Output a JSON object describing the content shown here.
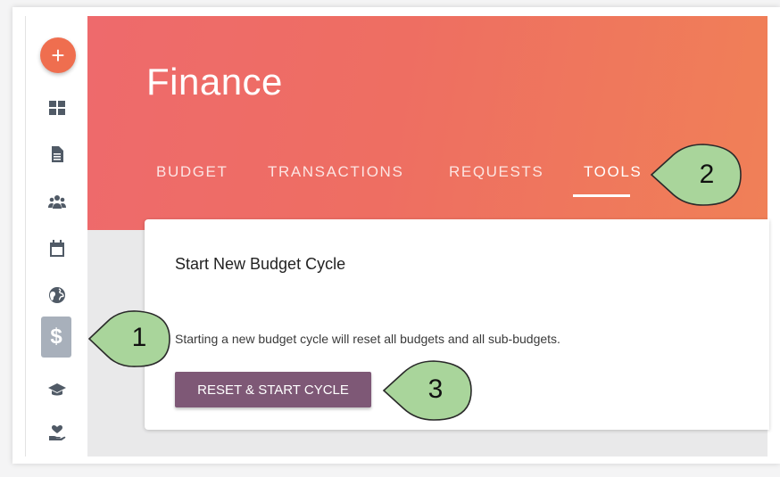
{
  "sidebar": {
    "add_button_symbol": "+",
    "items": [
      {
        "name": "dashboard",
        "icon": "grid-icon"
      },
      {
        "name": "documents",
        "icon": "document-icon"
      },
      {
        "name": "people",
        "icon": "people-icon"
      },
      {
        "name": "calendar",
        "icon": "calendar-icon"
      },
      {
        "name": "globe",
        "icon": "globe-icon"
      },
      {
        "name": "finance",
        "icon": "dollar-icon",
        "symbol": "$",
        "active": true
      },
      {
        "name": "education",
        "icon": "graduation-cap-icon"
      },
      {
        "name": "giving",
        "icon": "hand-heart-icon"
      }
    ]
  },
  "header": {
    "title": "Finance",
    "gradient_colors": [
      "#ee6a6c",
      "#f08057"
    ]
  },
  "tabs": [
    {
      "label": "BUDGET"
    },
    {
      "label": "TRANSACTIONS"
    },
    {
      "label": "REQUESTS"
    },
    {
      "label": "TOOLS",
      "active": true
    }
  ],
  "card": {
    "title": "Start New Budget Cycle",
    "description": "Starting a new budget cycle will reset all budgets and all sub-budgets.",
    "button_label": "RESET & START CYCLE",
    "button_color": "#7e5876"
  },
  "callouts": [
    {
      "number": "1",
      "color": "#a9d59b"
    },
    {
      "number": "2",
      "color": "#a9d59b"
    },
    {
      "number": "3",
      "color": "#a9d59b"
    }
  ]
}
